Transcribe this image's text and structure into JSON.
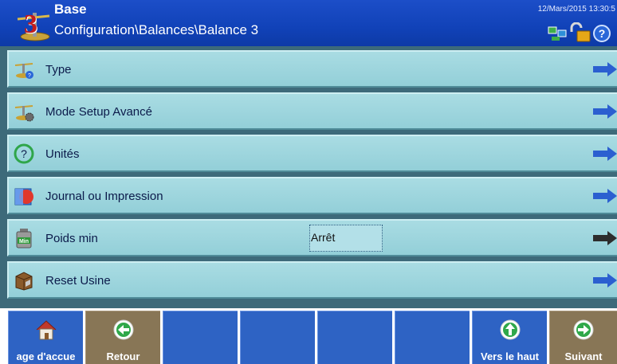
{
  "header": {
    "scale_number": "3",
    "title": "Base",
    "path": "Configuration\\Balances\\Balance 3",
    "datetime": "12/Mars/2015 13:30:5"
  },
  "menu": {
    "items": [
      {
        "label": "Type",
        "icon": "scale-type-icon"
      },
      {
        "label": "Mode Setup Avancé",
        "icon": "scale-gear-icon"
      },
      {
        "label": "Unités",
        "icon": "units-question-icon"
      },
      {
        "label": "Journal ou Impression",
        "icon": "journal-print-icon"
      },
      {
        "label": "Poids min",
        "icon": "min-weight-icon",
        "value": "Arrêt"
      },
      {
        "label": "Reset Usine",
        "icon": "factory-reset-icon"
      }
    ]
  },
  "softkeys": [
    {
      "label": "age d'accue",
      "icon": "home-icon"
    },
    {
      "label": "Retour",
      "icon": "back-arrow-icon"
    },
    {
      "label": ""
    },
    {
      "label": ""
    },
    {
      "label": ""
    },
    {
      "label": ""
    },
    {
      "label": "Vers le haut",
      "icon": "up-arrow-icon"
    },
    {
      "label": "Suivant",
      "icon": "next-arrow-icon"
    }
  ],
  "colors": {
    "header": "#1142b8",
    "row": "#a4d8df",
    "softkey_blue": "#2e63c4",
    "softkey_brown": "#887656",
    "arrow_blue": "#2b5fd0"
  }
}
